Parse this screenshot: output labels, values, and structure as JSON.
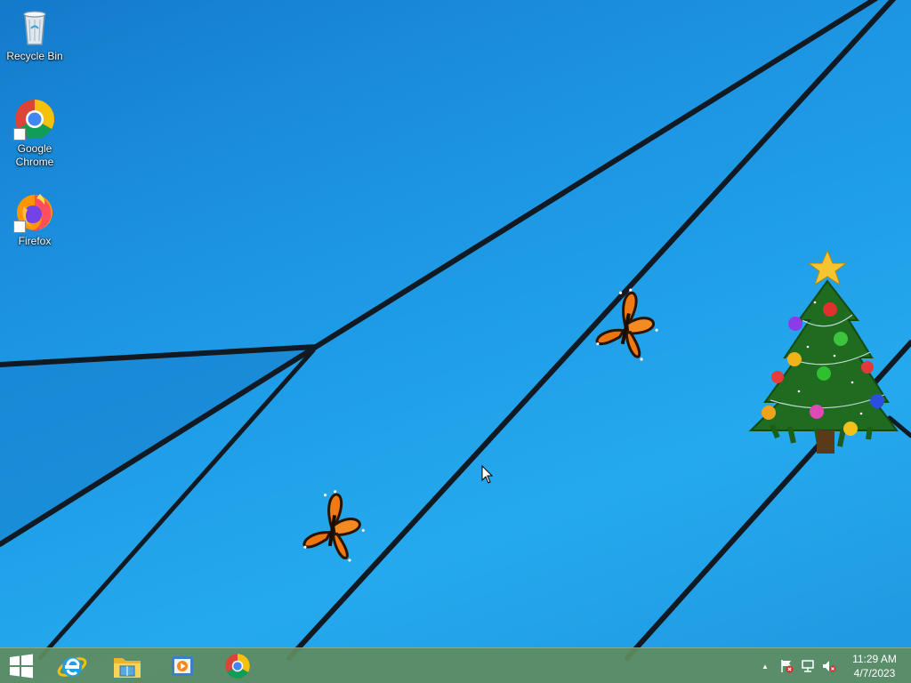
{
  "desktop": {
    "icons": [
      {
        "label": "Recycle Bin",
        "icon": "recycle-bin-icon"
      },
      {
        "label": "Google Chrome",
        "label_line1": "Google",
        "label_line2": "Chrome",
        "icon": "chrome-icon"
      },
      {
        "label": "Firefox",
        "icon": "firefox-icon"
      }
    ],
    "decorations": [
      "butterfly-icon",
      "butterfly-icon",
      "christmas-tree-icon"
    ]
  },
  "taskbar": {
    "pinned": [
      {
        "name": "start-button",
        "icon": "windows-logo-icon"
      },
      {
        "name": "internet-explorer",
        "icon": "internet-explorer-icon"
      },
      {
        "name": "file-explorer",
        "icon": "file-explorer-icon"
      },
      {
        "name": "media-player",
        "icon": "media-player-icon"
      },
      {
        "name": "google-chrome",
        "icon": "chrome-icon"
      }
    ],
    "tray": {
      "icons": [
        "show-hidden-icons-arrow-icon",
        "action-center-flag-icon",
        "network-icon",
        "volume-muted-icon"
      ],
      "show_hidden_glyph": "▲",
      "time": "11:29 AM",
      "date": "4/7/2023"
    }
  },
  "colors": {
    "wallpaper_blue": "#1e9be6",
    "taskbar_green": "#5f8c5f",
    "chrome_red": "#db4437",
    "chrome_yellow": "#f4c20d",
    "chrome_green": "#0f9d58",
    "chrome_blue": "#4285f4"
  }
}
